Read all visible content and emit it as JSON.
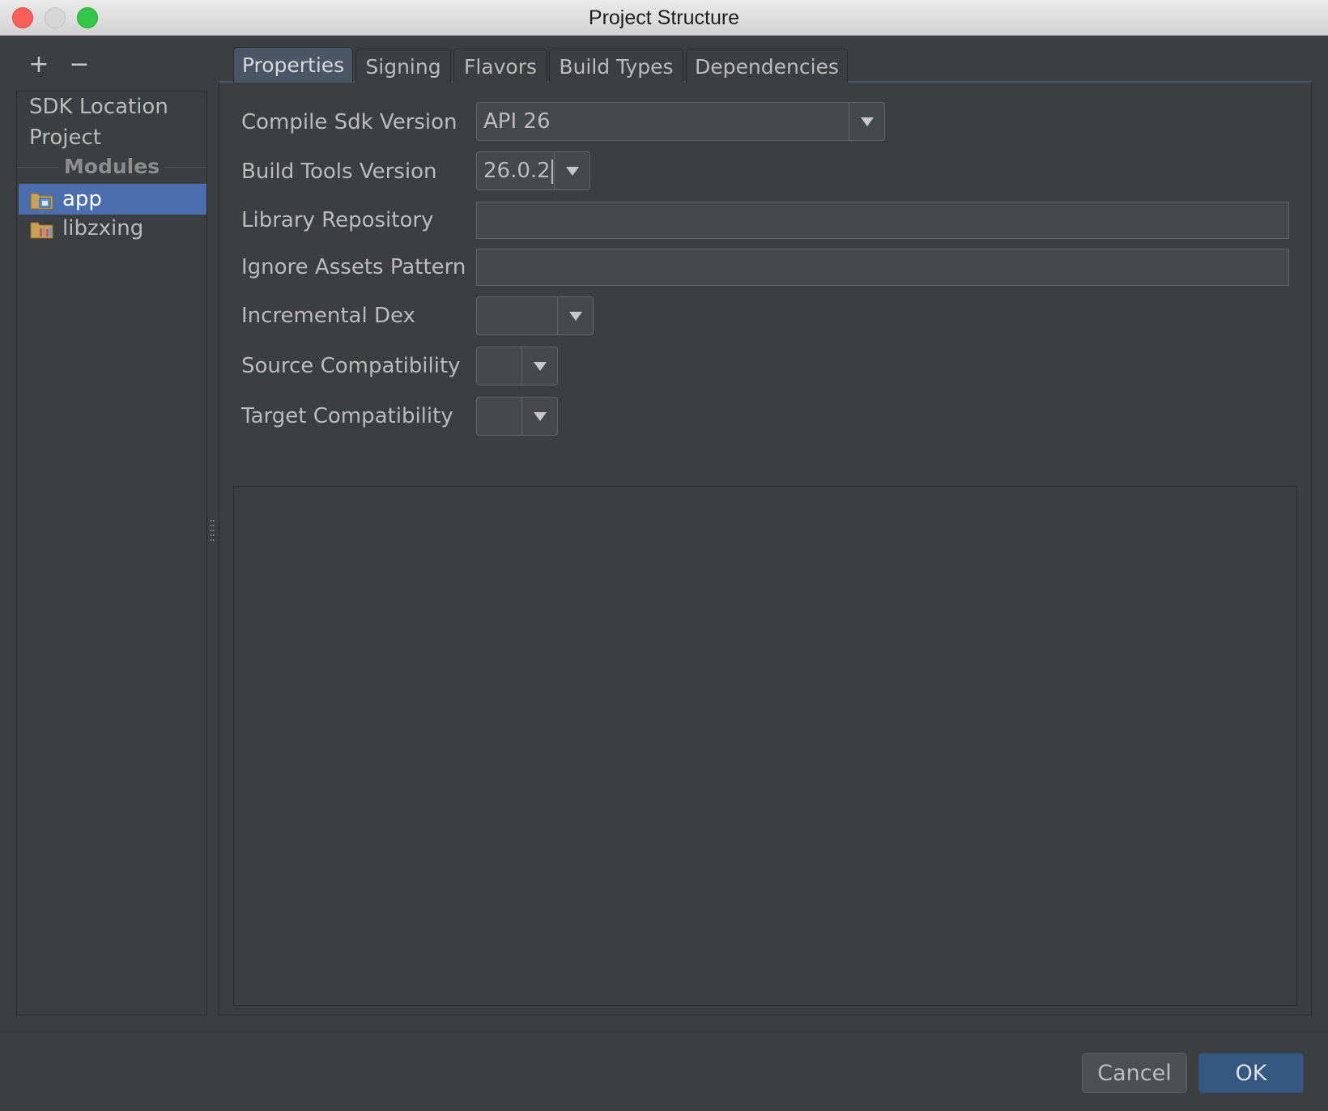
{
  "window": {
    "title": "Project Structure"
  },
  "toolbar": {
    "add_label": "+",
    "remove_label": "−"
  },
  "sidebar": {
    "items": [
      "SDK Location",
      "Project"
    ],
    "section_label": "Modules",
    "modules": [
      {
        "label": "app",
        "selected": true,
        "icon": "android-module-folder-icon"
      },
      {
        "label": "libzxing",
        "selected": false,
        "icon": "library-module-folder-icon"
      }
    ]
  },
  "tabs": [
    {
      "label": "Properties",
      "active": true
    },
    {
      "label": "Signing",
      "active": false
    },
    {
      "label": "Flavors",
      "active": false
    },
    {
      "label": "Build Types",
      "active": false
    },
    {
      "label": "Dependencies",
      "active": false
    }
  ],
  "form": {
    "compile_sdk": {
      "label": "Compile Sdk Version",
      "value": "API 26"
    },
    "build_tools": {
      "label": "Build Tools Version",
      "value": "26.0.2"
    },
    "library_repo": {
      "label": "Library Repository",
      "value": ""
    },
    "ignore_assets": {
      "label": "Ignore Assets Pattern",
      "value": ""
    },
    "incremental_dex": {
      "label": "Incremental Dex",
      "value": ""
    },
    "source_compat": {
      "label": "Source Compatibility",
      "value": ""
    },
    "target_compat": {
      "label": "Target Compatibility",
      "value": ""
    }
  },
  "buttons": {
    "cancel": "Cancel",
    "ok": "OK"
  },
  "colors": {
    "background": "#3c3f41",
    "selection": "#4b6eaf",
    "ok_button": "#365880",
    "active_tab": "#4a5666"
  }
}
